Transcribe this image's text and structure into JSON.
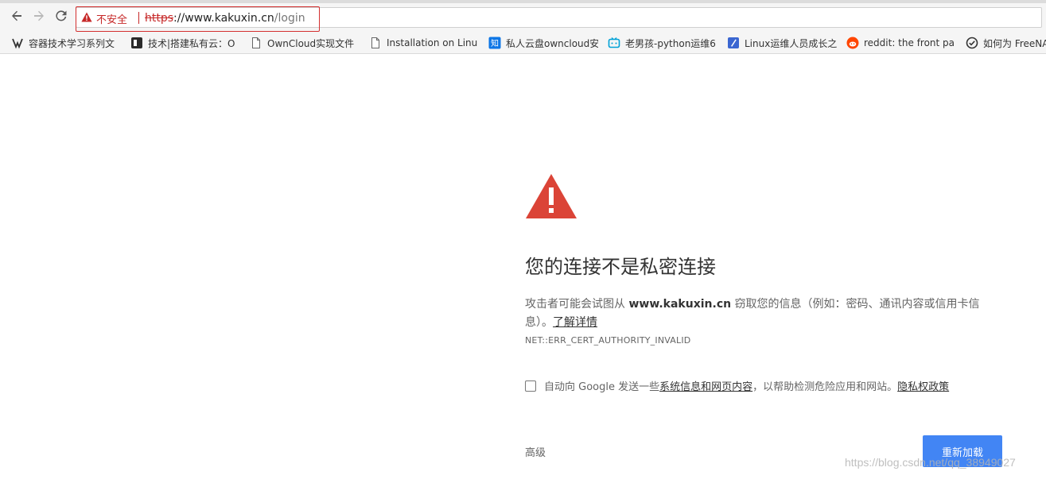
{
  "colors": {
    "danger": "#c62828",
    "warning_triangle": "#db4437",
    "primary_button": "#4285f4"
  },
  "toolbar": {
    "back_icon": "arrow-left-icon",
    "forward_icon": "arrow-right-icon",
    "reload_icon": "reload-icon",
    "security_label": "不安全",
    "url_scheme": "https",
    "url_host": "://www.kakuxin.cn",
    "url_path": "/login"
  },
  "bookmarks": [
    {
      "icon": "quay-icon",
      "label": "容器技术学习系列文"
    },
    {
      "icon": "dark-square-icon",
      "label": "技术|搭建私有云：O"
    },
    {
      "icon": "page-icon",
      "label": "OwnCloud实现文件"
    },
    {
      "icon": "page-icon",
      "label": "Installation on Linu"
    },
    {
      "icon": "zhihu-icon",
      "label": "私人云盘owncloud安"
    },
    {
      "icon": "bilibili-icon",
      "label": "老男孩-python运维6"
    },
    {
      "icon": "blue-pen-icon",
      "label": "Linux运维人员成长之"
    },
    {
      "icon": "reddit-icon",
      "label": "reddit: the front pa"
    },
    {
      "icon": "check-circle-icon",
      "label": "如何为 FreeNA"
    }
  ],
  "interstitial": {
    "heading": "您的连接不是私密连接",
    "explanation_prefix": "攻击者可能会试图从 ",
    "explanation_host": "www.kakuxin.cn",
    "explanation_suffix": " 窃取您的信息（例如：密码、通讯内容或信用卡信息）。",
    "learn_more": "了解详情",
    "error_code": "NET::ERR_CERT_AUTHORITY_INVALID",
    "optin_prefix": "自动向 Google 发送一些",
    "optin_link": "系统信息和网页内容",
    "optin_middle": "，以帮助检测危险应用和网站。",
    "optin_privacy": "隐私权政策",
    "advanced": "高级",
    "reload": "重新加载"
  },
  "watermark": "https://blog.csdn.net/qq_38949027"
}
